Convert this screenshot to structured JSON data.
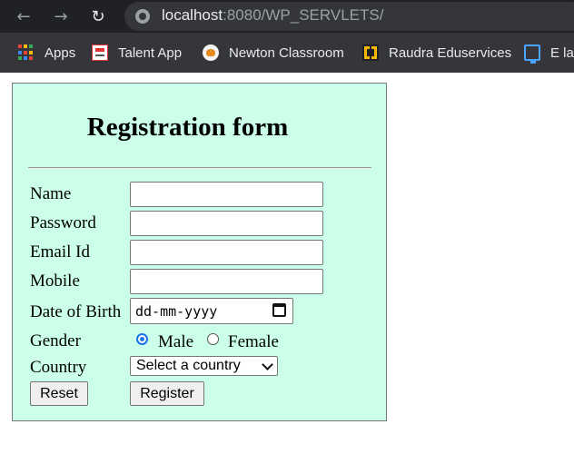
{
  "browser": {
    "url_host": "localhost",
    "url_rest": ":8080/WP_SERVLETS/",
    "bookmarks": [
      {
        "label": "Apps",
        "icon": "apps-grid-icon"
      },
      {
        "label": "Talent App",
        "icon": "talent-app-icon"
      },
      {
        "label": "Newton Classroom",
        "icon": "newton-icon"
      },
      {
        "label": "Raudra Eduservices",
        "icon": "raudra-icon"
      },
      {
        "label": "E lab",
        "icon": "elab-icon"
      }
    ]
  },
  "form": {
    "title": "Registration form",
    "background": "#ccffea",
    "labels": {
      "name": "Name",
      "password": "Password",
      "email": "Email Id",
      "mobile": "Mobile",
      "dob": "Date of Birth",
      "gender": "Gender",
      "country": "Country"
    },
    "values": {
      "name": "",
      "password": "",
      "email": "",
      "mobile": ""
    },
    "dob_placeholder": "dd-mm-yyyy",
    "gender_options": [
      {
        "label": "Male",
        "checked": true
      },
      {
        "label": "Female",
        "checked": false
      }
    ],
    "country_selected": "Select a country",
    "buttons": {
      "reset": "Reset",
      "register": "Register"
    }
  }
}
